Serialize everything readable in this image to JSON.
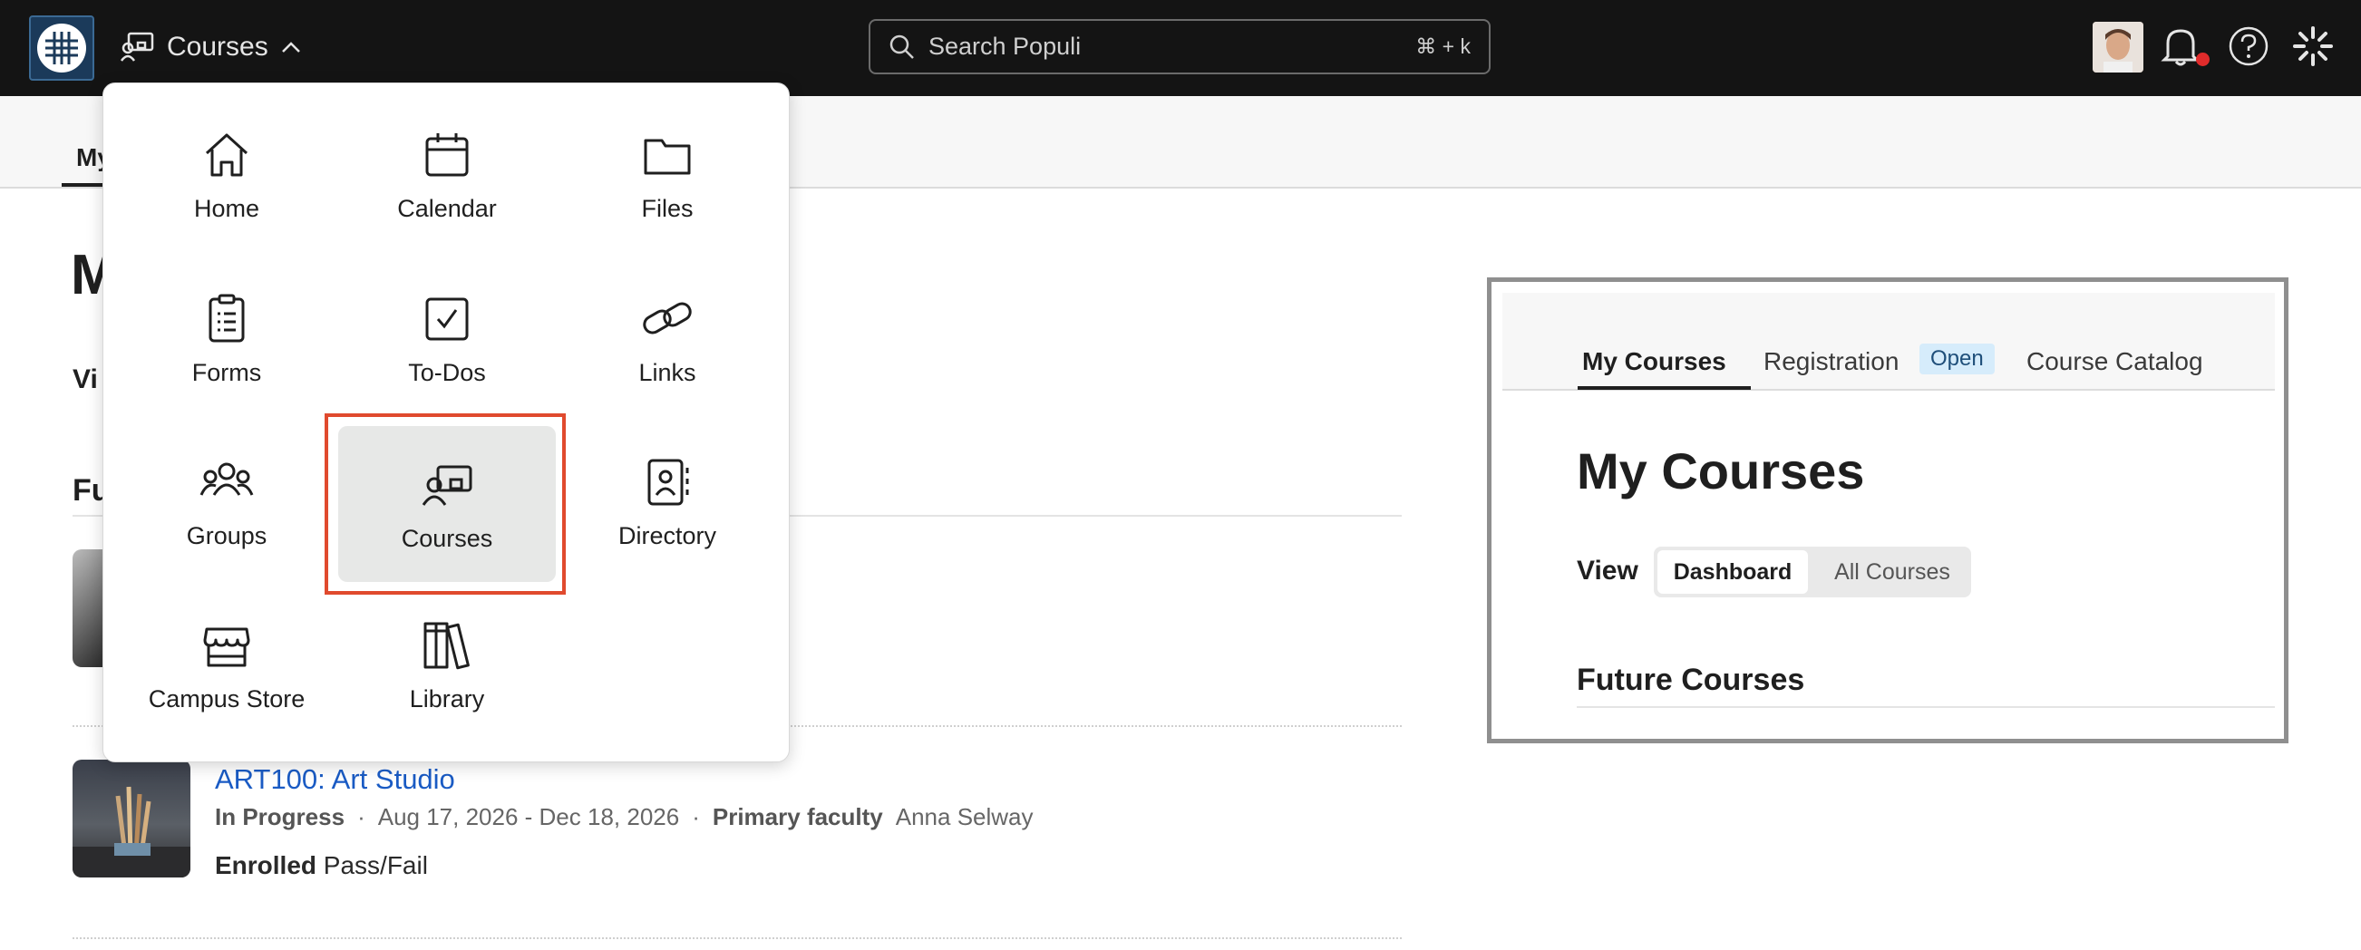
{
  "topbar": {
    "nav_label": "Courses",
    "search_placeholder": "Search Populi",
    "search_shortcut": "⌘ + k"
  },
  "page": {
    "tab_partial": "My",
    "title_partial": "M",
    "view_partial": "Vi",
    "section_partial": "Fu",
    "course": {
      "title": "ART100: Art Studio",
      "status": "In Progress",
      "dates": "Aug 17, 2026 - Dec 18, 2026",
      "faculty_label": "Primary faculty",
      "faculty_name": "Anna Selway",
      "enroll_label": "Enrolled",
      "enroll_value": "Pass/Fail"
    }
  },
  "menu": {
    "items": [
      {
        "label": "Home",
        "icon": "home-icon"
      },
      {
        "label": "Calendar",
        "icon": "calendar-icon"
      },
      {
        "label": "Files",
        "icon": "folder-icon"
      },
      {
        "label": "Forms",
        "icon": "clipboard-icon"
      },
      {
        "label": "To-Dos",
        "icon": "checkbox-icon"
      },
      {
        "label": "Links",
        "icon": "link-icon"
      },
      {
        "label": "Groups",
        "icon": "groups-icon"
      },
      {
        "label": "Courses",
        "icon": "courses-icon",
        "active": true
      },
      {
        "label": "Directory",
        "icon": "directory-icon"
      },
      {
        "label": "Campus Store",
        "icon": "store-icon"
      },
      {
        "label": "Library",
        "icon": "library-icon"
      }
    ]
  },
  "preview": {
    "tabs": [
      "My Courses",
      "Registration",
      "Course Catalog"
    ],
    "badge": "Open",
    "title": "My Courses",
    "view_label": "View",
    "segment_on": "Dashboard",
    "segment_off": "All Courses",
    "section": "Future Courses"
  },
  "colors": {
    "topbar": "#141414",
    "highlight": "#e04a2e",
    "link": "#1a5bc4",
    "badge_bg": "#d6ecfb"
  }
}
